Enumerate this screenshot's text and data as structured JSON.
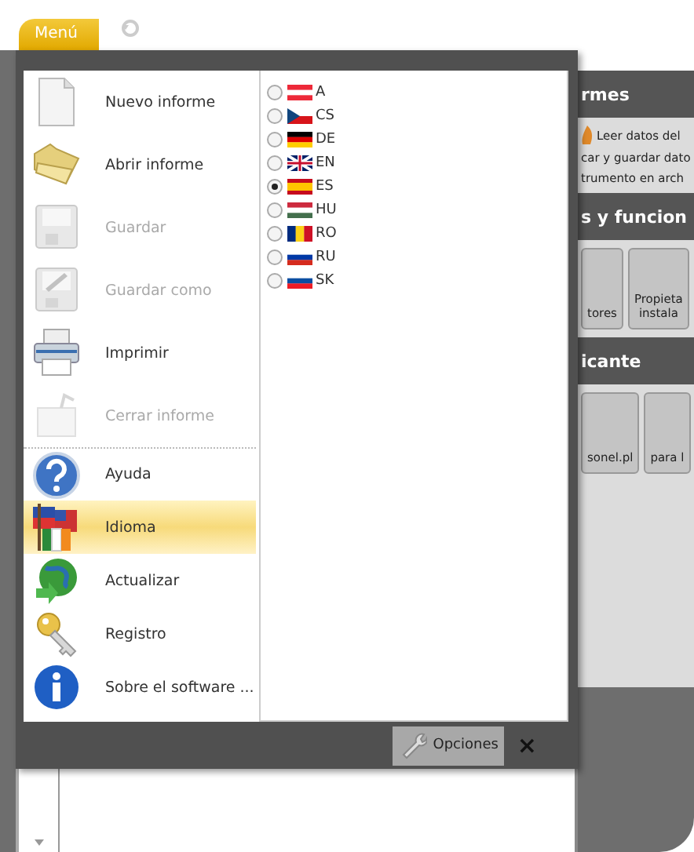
{
  "top_bar": {
    "menu_tab": "Menú"
  },
  "menu": {
    "items": [
      {
        "label": "Nuevo informe",
        "kind": "new",
        "disabled": false,
        "selected": false
      },
      {
        "label": "Abrir informe",
        "kind": "open",
        "disabled": false,
        "selected": false
      },
      {
        "label": "Guardar",
        "kind": "save",
        "disabled": true,
        "selected": false
      },
      {
        "label": "Guardar como",
        "kind": "saveas",
        "disabled": true,
        "selected": false
      },
      {
        "label": "Imprimir",
        "kind": "print",
        "disabled": false,
        "selected": false
      },
      {
        "label": "Cerrar informe",
        "kind": "close",
        "disabled": true,
        "selected": false
      },
      {
        "label": "Ayuda",
        "kind": "help",
        "disabled": false,
        "selected": false
      },
      {
        "label": "Idioma",
        "kind": "language",
        "disabled": false,
        "selected": true
      },
      {
        "label": "Actualizar",
        "kind": "update",
        "disabled": false,
        "selected": false
      },
      {
        "label": "Registro",
        "kind": "register",
        "disabled": false,
        "selected": false
      },
      {
        "label": "Sobre el software ...",
        "kind": "about",
        "disabled": false,
        "selected": false
      }
    ],
    "languages": [
      {
        "code": "A",
        "kind": "at",
        "selected": false
      },
      {
        "code": "CS",
        "kind": "cz",
        "selected": false
      },
      {
        "code": "DE",
        "kind": "de",
        "selected": false
      },
      {
        "code": "EN",
        "kind": "gb",
        "selected": false
      },
      {
        "code": "ES",
        "kind": "es",
        "selected": true
      },
      {
        "code": "HU",
        "kind": "hu",
        "selected": false
      },
      {
        "code": "RO",
        "kind": "ro",
        "selected": false
      },
      {
        "code": "RU",
        "kind": "ru",
        "selected": false
      },
      {
        "code": "SK",
        "kind": "sk",
        "selected": false
      }
    ],
    "options_button": "Opciones",
    "close_button": "×"
  },
  "side_panel": {
    "sections": [
      {
        "header": "rmes",
        "lines": [
          "Leer datos del",
          "car y guardar dato",
          "trumento en arch"
        ]
      },
      {
        "header": "s y funcion",
        "tiles": [
          [
            "tores"
          ],
          [
            "Propieta",
            "instala"
          ]
        ]
      },
      {
        "header": "icante",
        "tiles": [
          [
            "sonel.pl"
          ],
          [
            "para l"
          ]
        ]
      }
    ]
  }
}
